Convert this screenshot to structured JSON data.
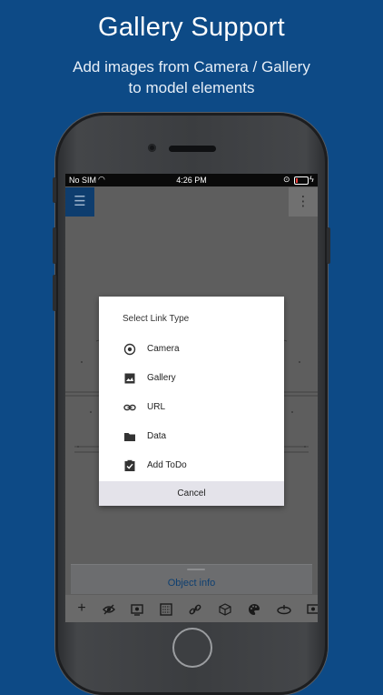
{
  "headline": {
    "title": "Gallery Support",
    "subtitle_line1": "Add images from Camera / Gallery",
    "subtitle_line2": "to model elements"
  },
  "status_bar": {
    "carrier": "No SIM",
    "time": "4:26 PM",
    "battery_level": 0.15,
    "battery_color": "#e53935"
  },
  "app": {
    "object_info_label": "Object info",
    "toolbar_icons": [
      "add-icon",
      "hide-icon",
      "view-icon",
      "texture-icon",
      "link-icon",
      "cube-icon",
      "palette-icon",
      "rotate-icon",
      "display-icon"
    ]
  },
  "dialog": {
    "title": "Select Link Type",
    "options": [
      {
        "label": "Camera",
        "icon": "camera-icon"
      },
      {
        "label": "Gallery",
        "icon": "gallery-icon"
      },
      {
        "label": "URL",
        "icon": "link-icon"
      },
      {
        "label": "Data",
        "icon": "folder-icon"
      },
      {
        "label": "Add ToDo",
        "icon": "todo-icon"
      }
    ],
    "cancel_label": "Cancel"
  },
  "colors": {
    "background": "#0d4a86",
    "accent": "#0e3d6e"
  }
}
